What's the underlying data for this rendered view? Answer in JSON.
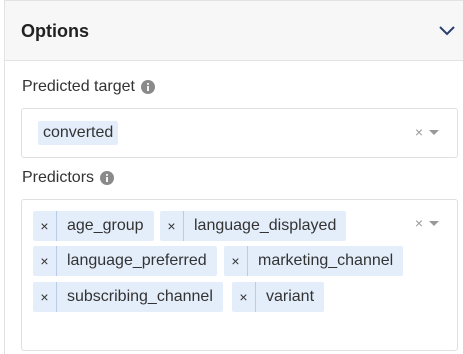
{
  "header": {
    "title": "Options",
    "toggle_icon": "chevron-down-icon"
  },
  "predicted_target": {
    "label": "Predicted target",
    "info_icon": "info-icon",
    "selected": [
      "converted"
    ],
    "clear_glyph": "×"
  },
  "predictors": {
    "label": "Predictors",
    "info_icon": "info-icon",
    "selected": [
      "age_group",
      "language_displayed",
      "language_preferred",
      "marketing_channel",
      "subscribing_channel",
      "variant"
    ],
    "remove_glyph": "×",
    "clear_glyph": "×"
  },
  "colors": {
    "tag_bg": "#e4eefb",
    "accent": "#2a3f6e"
  }
}
